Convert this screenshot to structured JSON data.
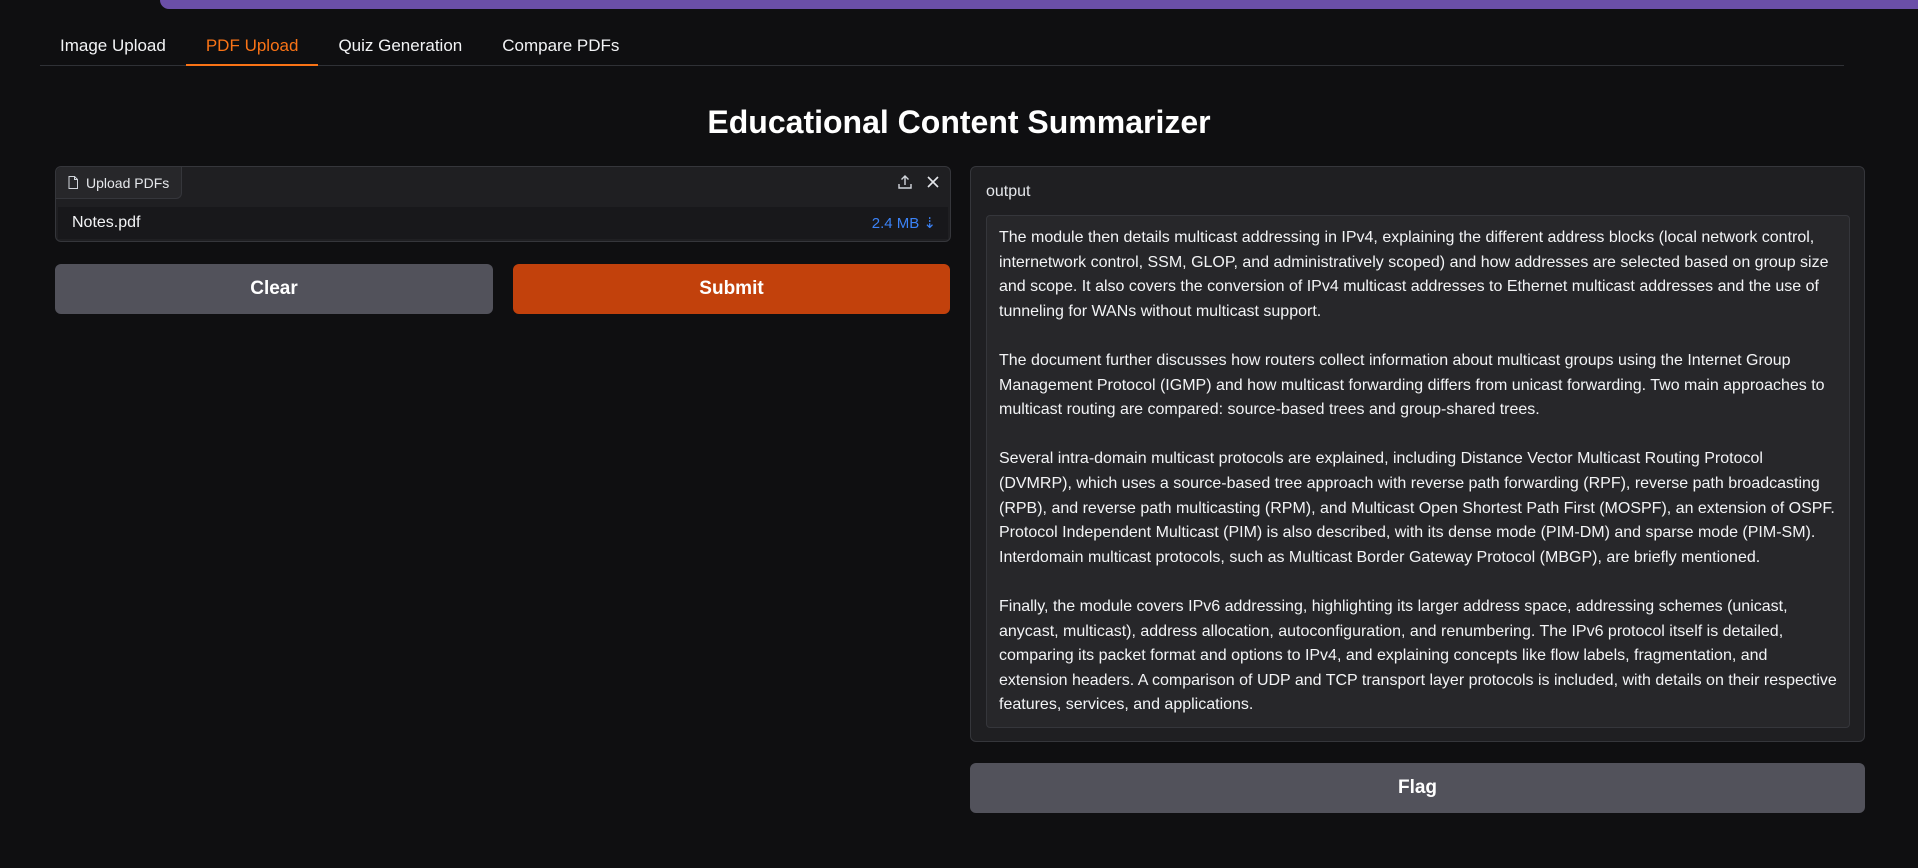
{
  "tabs": [
    {
      "label": "Image Upload"
    },
    {
      "label": "PDF Upload"
    },
    {
      "label": "Quiz Generation"
    },
    {
      "label": "Compare PDFs"
    }
  ],
  "title": "Educational Content Summarizer",
  "upload": {
    "label": "Upload PDFs",
    "file_name": "Notes.pdf",
    "file_size": "2.4 MB ⇣"
  },
  "buttons": {
    "clear": "Clear",
    "submit": "Submit",
    "flag": "Flag"
  },
  "output": {
    "label": "output",
    "paragraphs": [
      "The module then details multicast addressing in IPv4, explaining the different address blocks (local network control, internetwork control, SSM, GLOP, and administratively scoped) and how addresses are selected based on group size and scope.  It also covers the conversion of IPv4 multicast addresses to Ethernet multicast addresses and the use of tunneling for WANs without multicast support.",
      "The document further discusses how routers collect information about multicast groups using the Internet Group Management Protocol (IGMP) and how multicast forwarding differs from unicast forwarding.  Two main approaches to multicast routing are compared: source-based trees and group-shared trees.",
      "Several intra-domain multicast protocols are explained, including Distance Vector Multicast Routing Protocol (DVMRP), which uses a source-based tree approach with reverse path forwarding (RPF), reverse path broadcasting (RPB), and reverse path multicasting (RPM), and Multicast Open Shortest Path First (MOSPF), an extension of OSPF.  Protocol Independent Multicast (PIM) is also described, with its dense mode (PIM-DM) and sparse mode (PIM-SM).  Interdomain multicast protocols, such as Multicast Border Gateway Protocol (MBGP), are briefly mentioned.",
      "Finally, the module covers IPv6 addressing, highlighting its larger address space, addressing schemes (unicast, anycast, multicast), address allocation, autoconfiguration, and renumbering.  The IPv6 protocol itself is detailed, comparing its packet format and options to IPv4, and explaining concepts like flow labels, fragmentation, and extension headers.  A comparison of UDP and TCP transport layer protocols is included, with details on their respective features, services, and applications."
    ]
  },
  "colors": {
    "accent": "#f97316",
    "submit": "#c2410c",
    "top_bar": "#6b4fa8",
    "file_size": "#3b82f6"
  },
  "icons": [
    "file-icon",
    "upload-icon",
    "close-icon",
    "download-arrow-icon"
  ],
  "active_tab": "PDF Upload"
}
